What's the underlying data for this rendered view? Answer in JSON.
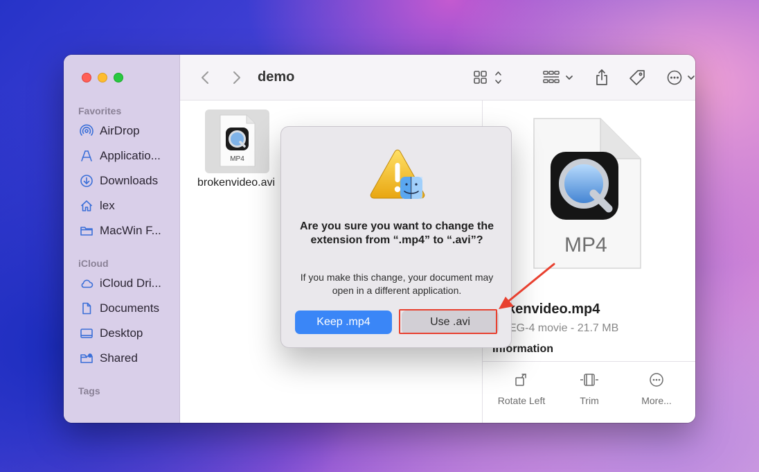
{
  "window": {
    "title": "demo"
  },
  "sidebar": {
    "favorites_label": "Favorites",
    "favorites": [
      {
        "label": "AirDrop",
        "icon": "airdrop-icon"
      },
      {
        "label": "Applicatio...",
        "icon": "applications-icon"
      },
      {
        "label": "Downloads",
        "icon": "downloads-icon"
      },
      {
        "label": "lex",
        "icon": "home-icon"
      },
      {
        "label": "MacWin F...",
        "icon": "folder-icon"
      }
    ],
    "icloud_label": "iCloud",
    "icloud": [
      {
        "label": "iCloud Dri...",
        "icon": "cloud-icon"
      },
      {
        "label": "Documents",
        "icon": "document-icon"
      },
      {
        "label": "Desktop",
        "icon": "desktop-icon"
      },
      {
        "label": "Shared",
        "icon": "shared-folder-icon"
      }
    ],
    "tags_label": "Tags"
  },
  "content": {
    "file": {
      "name": "brokenvideo.avi",
      "thumb_label": "MP4"
    }
  },
  "preview": {
    "badge_label": "MP4",
    "file_name": "kenvideo.mp4",
    "file_meta": "EG-4 movie - 21.7 MB",
    "info_label": "Information",
    "actions": [
      {
        "label": "Rotate Left",
        "icon": "rotate-left-icon"
      },
      {
        "label": "Trim",
        "icon": "trim-icon"
      },
      {
        "label": "More...",
        "icon": "more-icon"
      }
    ]
  },
  "dialog": {
    "title": "Are you sure you want to change the extension from “.mp4” to “.avi”?",
    "message": "If you make this change, your document may open in a different application.",
    "keep_label": "Keep .mp4",
    "use_label": "Use .avi"
  },
  "colors": {
    "accent": "#3a86f7",
    "annotation": "#e8402f"
  }
}
